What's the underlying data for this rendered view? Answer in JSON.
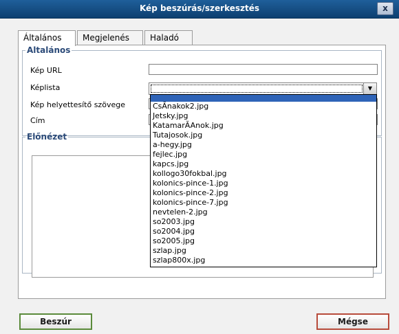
{
  "window": {
    "title": "Kép beszúrás/szerkesztés",
    "close_label": "x"
  },
  "tabs": [
    {
      "label": "Általános"
    },
    {
      "label": "Megjelenés"
    },
    {
      "label": "Haladó"
    }
  ],
  "general": {
    "legend": "Általános",
    "image_url_label": "Kép URL",
    "image_url_value": "",
    "image_list_label": "Képlista",
    "image_list_value": "",
    "alt_text_label": "Kép helyettesítő szövege",
    "title_label": "Cím"
  },
  "preview": {
    "legend": "Előnézet"
  },
  "image_list_options": [
    "CsĂnakok2.jpg",
    "Jetsky.jpg",
    "KatamarĂAnok.jpg",
    "Tutajosok.jpg",
    "a-hegy.jpg",
    "fejlec.jpg",
    "kapcs.jpg",
    "kollogo30fokbal.jpg",
    "kolonics-pince-1.jpg",
    "kolonics-pince-2.jpg",
    "kolonics-pince-7.jpg",
    "nevtelen-2.jpg",
    "so2003.jpg",
    "so2004.jpg",
    "so2005.jpg",
    "szlap.jpg",
    "szlap800x.jpg"
  ],
  "buttons": {
    "insert": "Beszúr",
    "cancel": "Mégse"
  },
  "colors": {
    "titlebar": "#1f5f9a",
    "legend": "#2b4a78",
    "selected": "#2f64b8",
    "insert_border": "#5a8a3a",
    "cancel_border": "#b74a3a"
  }
}
